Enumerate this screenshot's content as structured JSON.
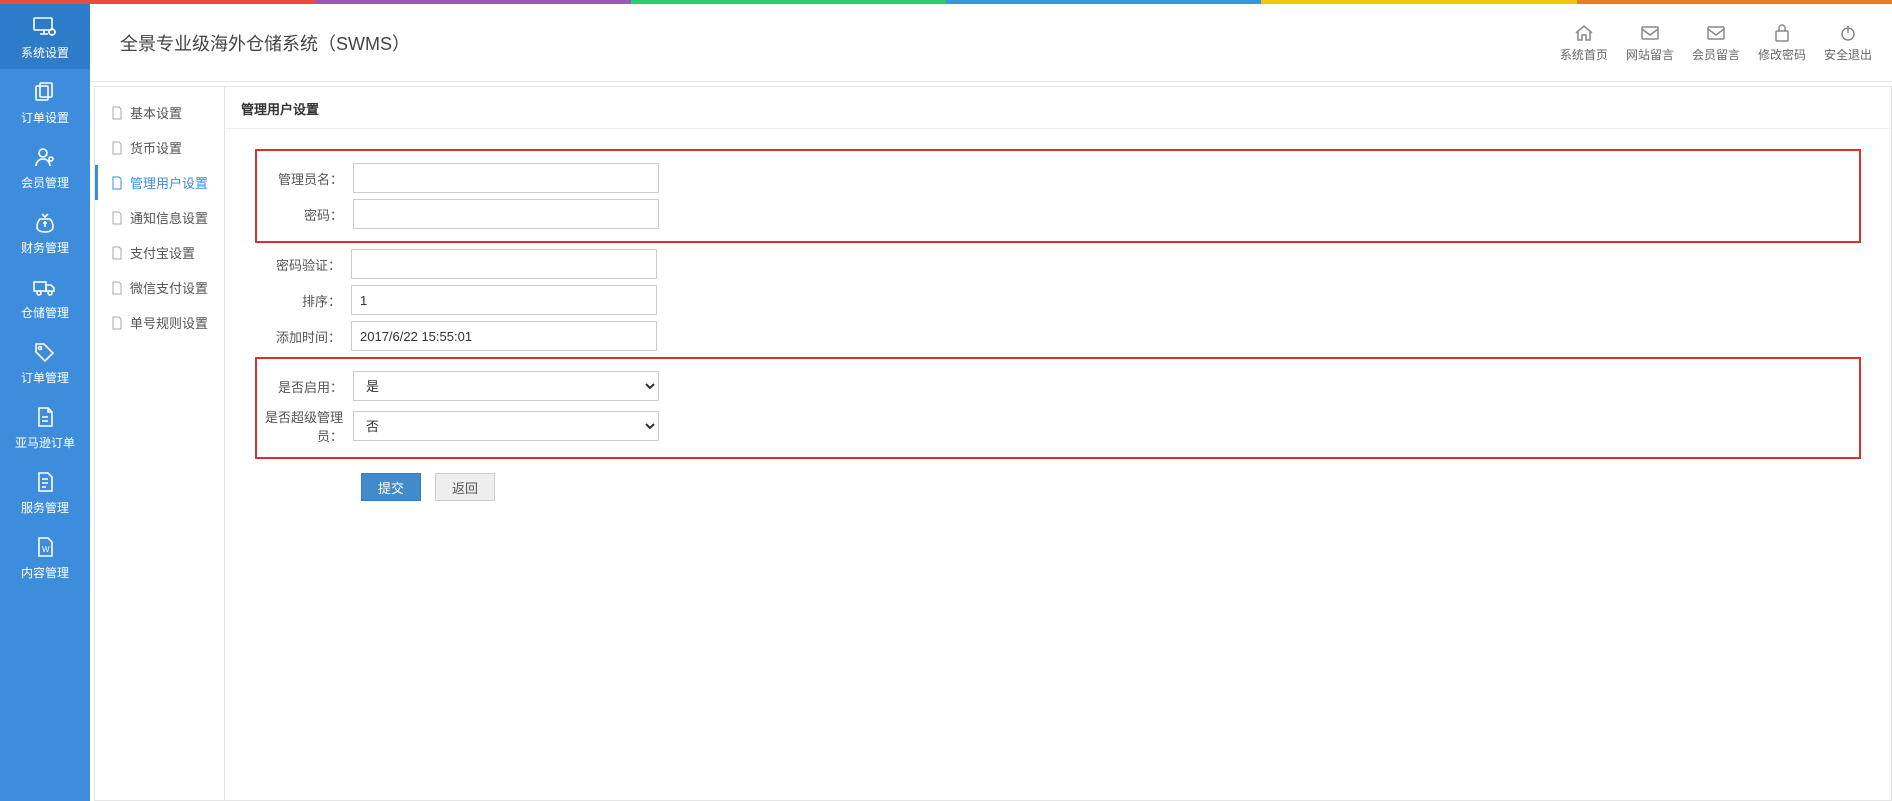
{
  "header": {
    "title": "全景专业级海外仓储系统（SWMS）",
    "actions": {
      "home": "系统首页",
      "site_msg": "网站留言",
      "member_msg": "会员留言",
      "change_pwd": "修改密码",
      "logout": "安全退出"
    }
  },
  "leftnav": {
    "system": "系统设置",
    "order": "订单设置",
    "member": "会员管理",
    "finance": "财务管理",
    "warehouse": "仓储管理",
    "order_mgmt": "订单管理",
    "amazon": "亚马逊订单",
    "service": "服务管理",
    "content": "内容管理"
  },
  "subnav": {
    "basic": "基本设置",
    "currency": "货币设置",
    "admin_user": "管理用户设置",
    "notify": "通知信息设置",
    "alipay": "支付宝设置",
    "wechat": "微信支付设置",
    "number_rule": "单号规则设置"
  },
  "content": {
    "title": "管理用户设置",
    "labels": {
      "admin_name": "管理员名：",
      "password": "密码：",
      "password_confirm": "密码验证：",
      "sort": "排序：",
      "add_time": "添加时间：",
      "enabled": "是否启用：",
      "is_super": "是否超级管理员："
    },
    "values": {
      "admin_name": "",
      "password": "",
      "password_confirm": "",
      "sort": "1",
      "add_time": "2017/6/22 15:55:01",
      "enabled": "是",
      "is_super": "否"
    },
    "options": {
      "yes": "是",
      "no": "否"
    },
    "buttons": {
      "submit": "提交",
      "back": "返回"
    }
  }
}
